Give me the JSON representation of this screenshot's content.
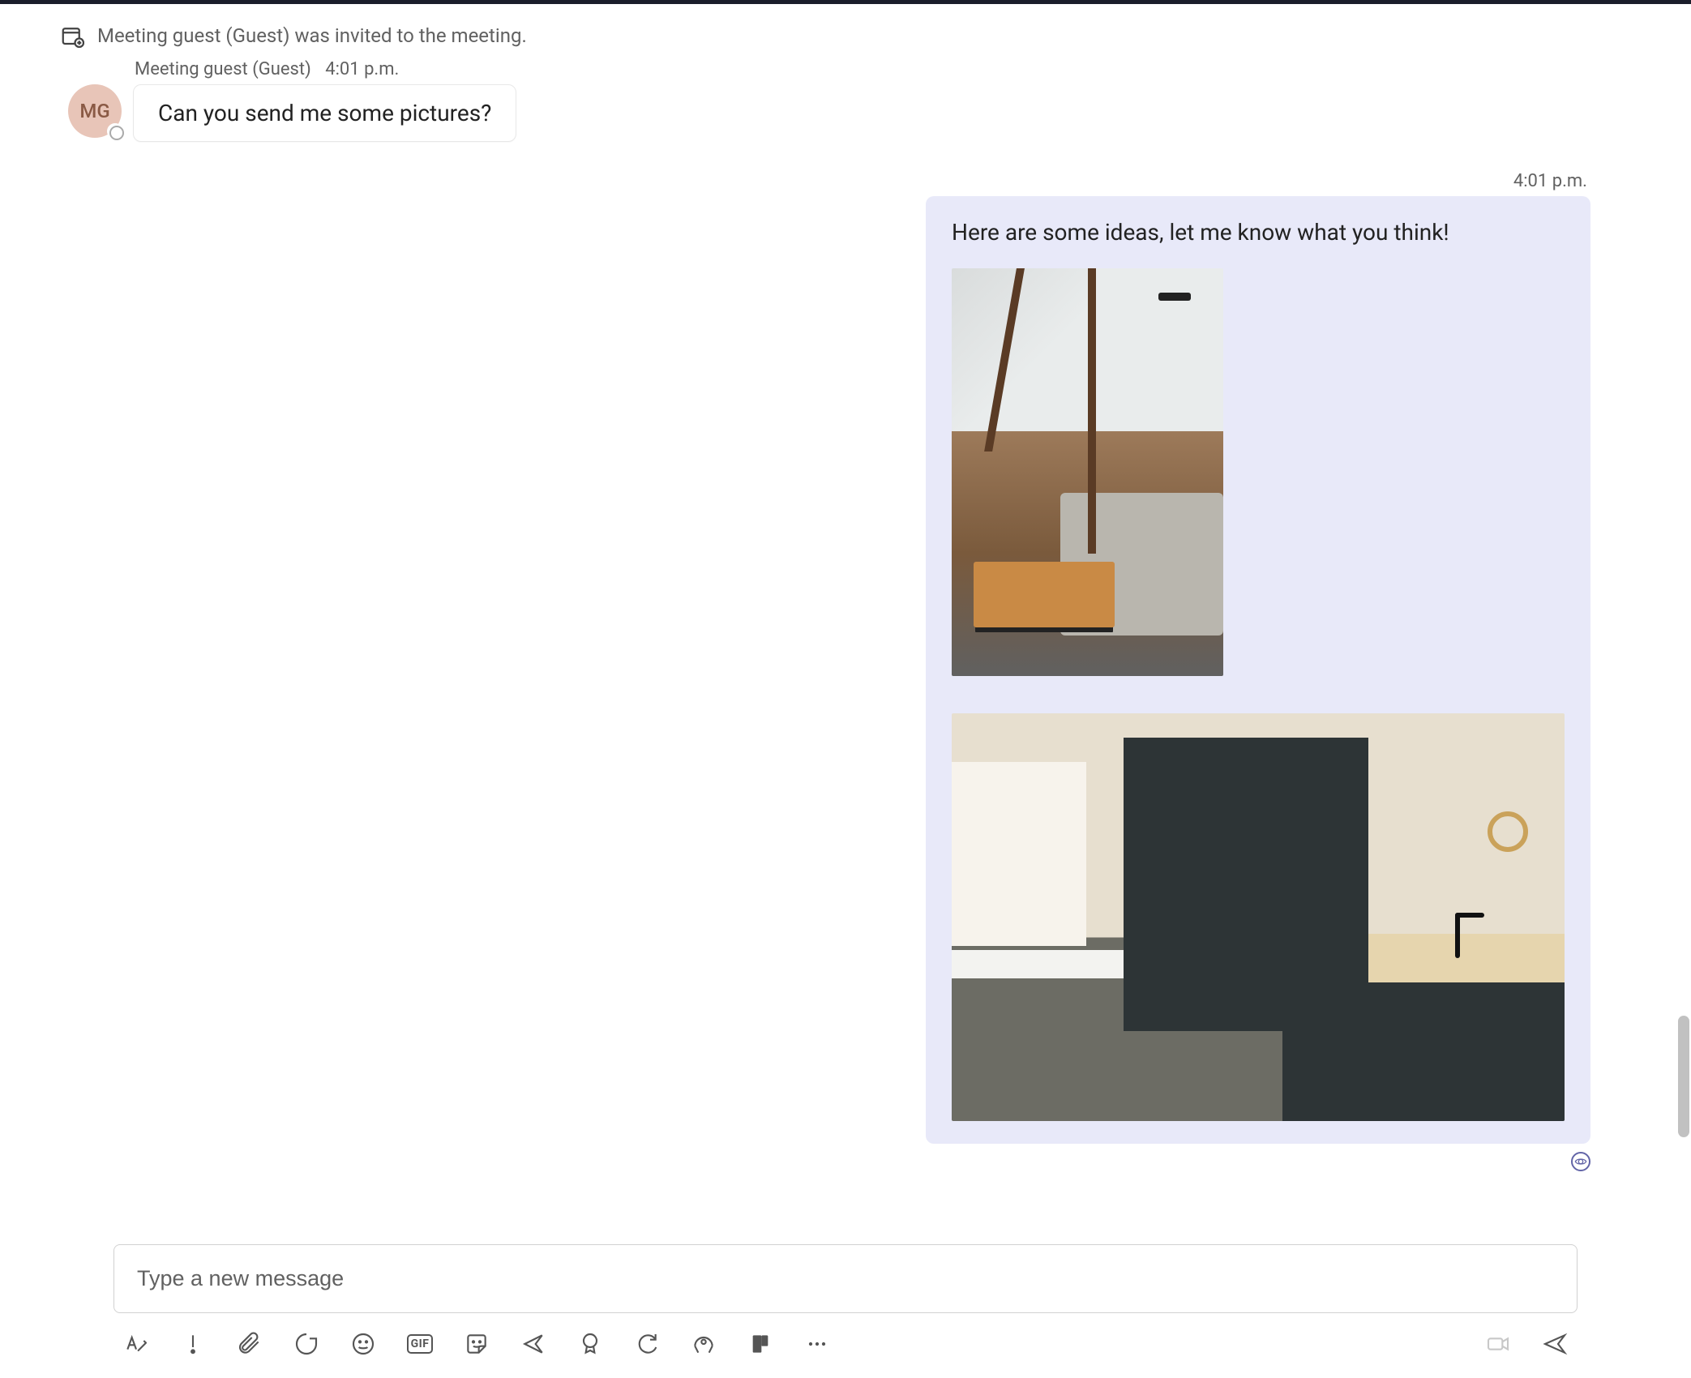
{
  "system_event": {
    "icon": "calendar-add-icon",
    "text": "Meeting guest (Guest) was invited to the meeting."
  },
  "incoming": {
    "sender": "Meeting guest (Guest)",
    "timestamp": "4:01 p.m.",
    "avatar_initials": "MG",
    "message": "Can you send me some pictures?"
  },
  "outgoing": {
    "timestamp": "4:01 p.m.",
    "message": "Here are some ideas, let me know what you think!",
    "attachments": [
      {
        "name": "interior-livingroom-image",
        "alt": "Living room with vaulted ceiling and wooden coffee table"
      },
      {
        "name": "interior-kitchen-image",
        "alt": "Modern kitchen with dark cabinets and wood island countertop"
      }
    ],
    "read_receipt": "seen"
  },
  "composer": {
    "placeholder": "Type a new message"
  },
  "toolbar": {
    "format": "Format",
    "priority": "Set delivery options",
    "attach": "Attach files",
    "loop": "Loop components",
    "emoji": "Emoji",
    "gif_label": "GIF",
    "sticker": "Sticker",
    "actions": "Actions",
    "approvals": "Approvals",
    "updates": "Updates",
    "stream": "Stream",
    "viva": "Viva",
    "more": "More options",
    "video": "Record video clip",
    "send": "Send"
  }
}
